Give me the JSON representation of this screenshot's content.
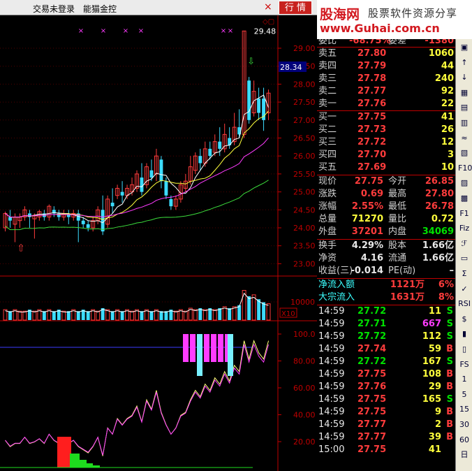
{
  "header": {
    "menu1": "交易未登录",
    "menu2": "能猫金控",
    "tab": "行 情",
    "close": "×"
  },
  "watermark": {
    "logo": "股海网",
    "slogan": "股票软件资源分享",
    "url": "www.Guhai.com.cn"
  },
  "chart": {
    "price_ticks": [
      "29.00",
      "28.50",
      "28.00",
      "27.50",
      "27.00",
      "26.50",
      "26.00",
      "25.50",
      "25.00",
      "24.50",
      "24.00",
      "23.50",
      "23.00"
    ],
    "current_price": "28.34",
    "high_label": "29.48",
    "vol_tick": "10000",
    "vol_unit": "X10",
    "ind_ticks": [
      "100.0",
      "80.00",
      "60.00",
      "40.00",
      "20.00"
    ],
    "top_mark": "◇▢",
    "up_arrow": "⇧",
    "down_arrow": "⇩"
  },
  "chart_data": {
    "type": "candlestick",
    "candles": [
      [
        24.0,
        24.4,
        23.9,
        24.45
      ],
      [
        24.3,
        24.2,
        24.0,
        24.5
      ],
      [
        24.1,
        24.3,
        23.6,
        24.4
      ],
      [
        24.2,
        24.3,
        24.0,
        24.4
      ],
      [
        24.3,
        24.5,
        24.2,
        24.6
      ],
      [
        24.4,
        24.3,
        24.0,
        24.5
      ],
      [
        24.25,
        24.35,
        23.7,
        24.4
      ],
      [
        24.3,
        24.45,
        24.2,
        24.5
      ],
      [
        24.4,
        24.3,
        24.2,
        24.5
      ],
      [
        24.3,
        24.6,
        24.2,
        24.65
      ],
      [
        24.5,
        24.4,
        24.3,
        24.6
      ],
      [
        24.4,
        24.3,
        24.2,
        24.5
      ],
      [
        24.3,
        24.4,
        24.2,
        24.5
      ],
      [
        24.4,
        24.3,
        24.1,
        24.5
      ],
      [
        24.3,
        24.4,
        24.2,
        24.5
      ],
      [
        24.4,
        24.2,
        23.6,
        24.5
      ],
      [
        24.2,
        24.1,
        24.0,
        24.3
      ],
      [
        24.1,
        24.0,
        23.9,
        24.2
      ],
      [
        24.0,
        24.2,
        23.9,
        24.3
      ],
      [
        24.2,
        24.5,
        24.1,
        24.6
      ],
      [
        24.5,
        23.9,
        23.8,
        24.9
      ],
      [
        24.1,
        24.8,
        24.0,
        24.9
      ],
      [
        24.7,
        24.6,
        24.4,
        25.1
      ],
      [
        24.9,
        25.1,
        24.8,
        25.2
      ],
      [
        25.0,
        24.9,
        24.7,
        25.3
      ],
      [
        24.9,
        25.1,
        24.8,
        25.2
      ],
      [
        25.0,
        25.2,
        24.9,
        25.4
      ],
      [
        25.1,
        25.5,
        25.0,
        25.6
      ],
      [
        25.4,
        25.0,
        24.9,
        25.8
      ],
      [
        25.2,
        25.7,
        25.1,
        25.8
      ],
      [
        25.6,
        25.4,
        25.3,
        25.9
      ],
      [
        25.5,
        26.0,
        25.3,
        26.2
      ],
      [
        25.9,
        25.3,
        25.1,
        26.0
      ],
      [
        25.3,
        24.9,
        24.8,
        25.4
      ],
      [
        24.8,
        24.6,
        24.5,
        24.9
      ],
      [
        24.6,
        24.8,
        24.5,
        24.9
      ],
      [
        24.8,
        25.2,
        24.7,
        25.3
      ],
      [
        25.1,
        25.3,
        25.0,
        25.5
      ],
      [
        25.3,
        25.7,
        25.2,
        26.0
      ],
      [
        25.6,
        26.0,
        25.5,
        26.1
      ],
      [
        26.0,
        25.8,
        25.6,
        26.2
      ],
      [
        25.8,
        26.2,
        25.7,
        26.4
      ],
      [
        26.2,
        26.0,
        25.9,
        26.4
      ],
      [
        26.1,
        26.4,
        26.0,
        26.6
      ],
      [
        26.4,
        26.2,
        26.0,
        26.8
      ],
      [
        26.2,
        26.6,
        26.1,
        26.9
      ],
      [
        26.5,
        26.3,
        26.2,
        26.8
      ],
      [
        26.4,
        26.8,
        26.3,
        27.2
      ],
      [
        26.8,
        26.6,
        26.5,
        27.3
      ],
      [
        26.6,
        29.48,
        26.5,
        29.48
      ],
      [
        28.1,
        27.0,
        26.9,
        28.2
      ],
      [
        27.2,
        27.8,
        27.1,
        28.1
      ],
      [
        27.6,
        27.2,
        27.0,
        27.9
      ],
      [
        27.6,
        27.0,
        26.7,
        27.9
      ],
      [
        27.2,
        27.75,
        27.0,
        27.85
      ]
    ],
    "ind_bars": [
      1.0,
      0.6,
      0.3,
      0.15,
      0.08
    ],
    "vol_values": [
      0.35,
      0.3,
      0.35,
      0.3,
      0.3,
      0.35,
      0.3,
      0.35,
      0.3,
      0.35,
      0.3,
      0.35,
      0.3,
      0.3,
      0.35,
      0.3,
      0.35,
      0.3,
      0.35,
      0.3,
      0.4,
      0.35,
      0.3,
      0.35,
      0.3,
      0.35,
      0.3,
      0.35,
      0.3,
      0.35,
      0.3,
      0.35,
      0.3,
      0.3,
      0.35,
      0.3,
      0.35,
      0.3,
      0.4,
      0.35,
      0.4,
      0.35,
      0.4,
      0.35,
      0.4,
      0.45,
      0.4,
      0.45,
      0.5,
      1.0,
      0.8,
      0.85,
      0.7,
      0.6,
      0.55
    ]
  },
  "orders": [
    {
      "label": "委比",
      "price": "-68.75%",
      "label2": "委差",
      "vol": "-1380"
    },
    {
      "label": "卖五",
      "price": "27.80",
      "vol": "1060"
    },
    {
      "label": "卖四",
      "price": "27.79",
      "vol": "44"
    },
    {
      "label": "卖三",
      "price": "27.78",
      "vol": "240"
    },
    {
      "label": "卖二",
      "price": "27.77",
      "vol": "92"
    },
    {
      "label": "卖一",
      "price": "27.76",
      "vol": "22"
    },
    {
      "label": "买一",
      "price": "27.75",
      "vol": "41"
    },
    {
      "label": "买二",
      "price": "27.73",
      "vol": "26"
    },
    {
      "label": "买三",
      "price": "27.72",
      "vol": "12"
    },
    {
      "label": "买四",
      "price": "27.70",
      "vol": "3"
    },
    {
      "label": "买五",
      "price": "27.69",
      "vol": "10"
    }
  ],
  "stats": [
    {
      "l1": "现价",
      "v1": "27.75",
      "c1": "red",
      "l2": "今开",
      "v2": "26.85",
      "c2": "red"
    },
    {
      "l1": "涨跌",
      "v1": "0.69",
      "c1": "red",
      "l2": "最高",
      "v2": "27.80",
      "c2": "red"
    },
    {
      "l1": "涨幅",
      "v1": "2.55%",
      "c1": "red",
      "l2": "最低",
      "v2": "26.78",
      "c2": "red"
    },
    {
      "l1": "总量",
      "v1": "71270",
      "c1": "yel",
      "l2": "量比",
      "v2": "0.72",
      "c2": "yel"
    },
    {
      "l1": "外盘",
      "v1": "37201",
      "c1": "red",
      "l2": "内盘",
      "v2": "34069",
      "c2": "grn"
    }
  ],
  "finance": [
    {
      "l1": "换手",
      "v1": "4.29%",
      "l2": "股本",
      "v2": "1.66亿"
    },
    {
      "l1": "净资",
      "v1": "4.16",
      "l2": "流通",
      "v2": "1.66亿"
    },
    {
      "l1": "收益(三)",
      "v1": "-0.014",
      "l2": "PE(动)",
      "v2": "–"
    }
  ],
  "flows": [
    {
      "label": "净流入额",
      "value": "1121万",
      "pct": "6%"
    },
    {
      "label": "大宗流入",
      "value": "1631万",
      "pct": "8%"
    }
  ],
  "ticks": [
    {
      "t": "14:59",
      "p": "27.72",
      "v": "11",
      "s": "S",
      "pc": "grn",
      "vc": "yel",
      "sc": "grn"
    },
    {
      "t": "14:59",
      "p": "27.71",
      "v": "667",
      "s": "S",
      "pc": "grn",
      "vc": "mag",
      "sc": "grn"
    },
    {
      "t": "14:59",
      "p": "27.72",
      "v": "112",
      "s": "S",
      "pc": "grn",
      "vc": "yel",
      "sc": "grn"
    },
    {
      "t": "14:59",
      "p": "27.74",
      "v": "59",
      "s": "B",
      "pc": "red",
      "vc": "yel",
      "sc": "red"
    },
    {
      "t": "14:59",
      "p": "27.72",
      "v": "167",
      "s": "S",
      "pc": "grn",
      "vc": "yel",
      "sc": "grn"
    },
    {
      "t": "14:59",
      "p": "27.75",
      "v": "108",
      "s": "B",
      "pc": "red",
      "vc": "yel",
      "sc": "red"
    },
    {
      "t": "14:59",
      "p": "27.76",
      "v": "29",
      "s": "B",
      "pc": "red",
      "vc": "yel",
      "sc": "red"
    },
    {
      "t": "14:59",
      "p": "27.75",
      "v": "165",
      "s": "S",
      "pc": "red",
      "vc": "yel",
      "sc": "grn"
    },
    {
      "t": "14:59",
      "p": "27.75",
      "v": "9",
      "s": "B",
      "pc": "red",
      "vc": "yel",
      "sc": "red"
    },
    {
      "t": "14:59",
      "p": "27.77",
      "v": "2",
      "s": "B",
      "pc": "red",
      "vc": "yel",
      "sc": "red"
    },
    {
      "t": "14:59",
      "p": "27.77",
      "v": "39",
      "s": "B",
      "pc": "red",
      "vc": "yel",
      "sc": "red"
    },
    {
      "t": "15:00",
      "p": "27.75",
      "v": "41",
      "s": "",
      "pc": "red",
      "vc": "yel",
      "sc": "red"
    }
  ],
  "toolbar": [
    "▣",
    "↑",
    "↓",
    "▦",
    "▤",
    "▥",
    "≈",
    "▧",
    "F10",
    "▨",
    "▩",
    "F1",
    "Fiz",
    "ℱ",
    "▭",
    "Σ",
    "✓",
    "RSI",
    "$",
    "▮",
    "▯",
    "FS",
    "1",
    "5",
    "15",
    "30",
    "60",
    "日"
  ],
  "colors": {
    "up": "#ff3c3c",
    "down": "#00e000",
    "frame": "#c00000"
  }
}
